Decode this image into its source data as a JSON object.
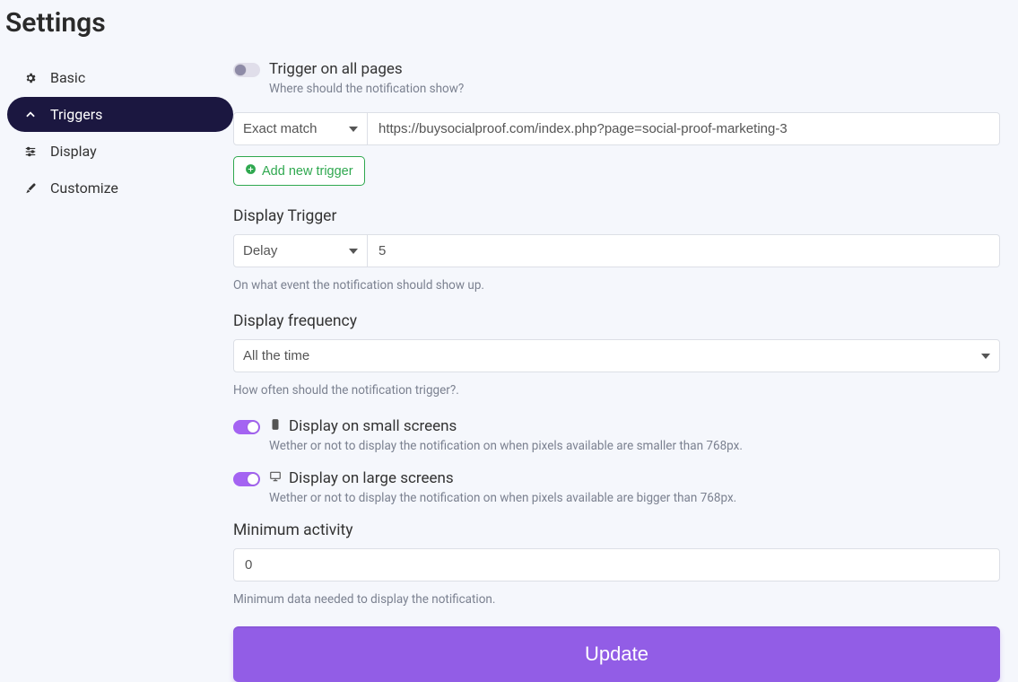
{
  "page": {
    "title": "Settings"
  },
  "sidebar": {
    "items": [
      {
        "label": "Basic"
      },
      {
        "label": "Triggers"
      },
      {
        "label": "Display"
      },
      {
        "label": "Customize"
      }
    ]
  },
  "triggers": {
    "all_pages": {
      "label": "Trigger on all pages",
      "help": "Where should the notification show?",
      "on": false
    },
    "rule": {
      "match_type": "Exact match",
      "url": "https://buysocialproof.com/index.php?page=social-proof-marketing-3"
    },
    "add_button": "Add new trigger",
    "display_trigger": {
      "label": "Display Trigger",
      "type": "Delay",
      "value": "5",
      "help": "On what event the notification should show up."
    },
    "frequency": {
      "label": "Display frequency",
      "value": "All the time",
      "help": "How often should the notification trigger?."
    },
    "small_screens": {
      "label": "Display on small screens",
      "help": "Wether or not to display the notification on when pixels available are smaller than 768px.",
      "on": true
    },
    "large_screens": {
      "label": "Display on large screens",
      "help": "Wether or not to display the notification on when pixels available are bigger than 768px.",
      "on": true
    },
    "min_activity": {
      "label": "Minimum activity",
      "value": "0",
      "help": "Minimum data needed to display the notification."
    },
    "update_button": "Update"
  }
}
